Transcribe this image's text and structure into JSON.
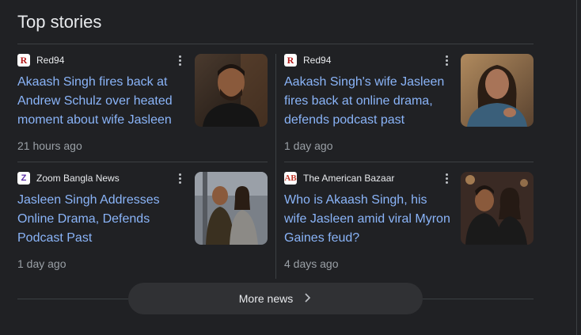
{
  "section_title": "Top stories",
  "stories": [
    {
      "source": "Red94",
      "favicon_text": "R",
      "headline": "Akaash Singh fires back at Andrew Schulz over heated moment about wife Jasleen",
      "time": "21 hours ago",
      "thumbnail": "man-portrait"
    },
    {
      "source": "Red94",
      "favicon_text": "R",
      "headline": "Aakash Singh's wife Jasleen fires back at online drama, defends podcast past",
      "time": "1 day ago",
      "thumbnail": "woman-portrait"
    },
    {
      "source": "Zoom Bangla News",
      "favicon_text": "Z",
      "headline": "Jasleen Singh Addresses Online Drama, Defends Podcast Past",
      "time": "1 day ago",
      "thumbnail": "couple-photo"
    },
    {
      "source": "The American Bazaar",
      "favicon_text": "AB",
      "headline": "Who is Akaash Singh, his wife Jasleen amid viral Myron Gaines feud?",
      "time": "4 days ago",
      "thumbnail": "couple-photo"
    }
  ],
  "more_button": {
    "label": "More news",
    "icon": "chevron-right-icon"
  },
  "colors": {
    "background": "#202124",
    "headline_link": "#8ab4f8",
    "text_primary": "#e8eaed",
    "text_secondary": "#9aa0a6",
    "divider": "#3c4043",
    "button_bg": "#303134"
  }
}
